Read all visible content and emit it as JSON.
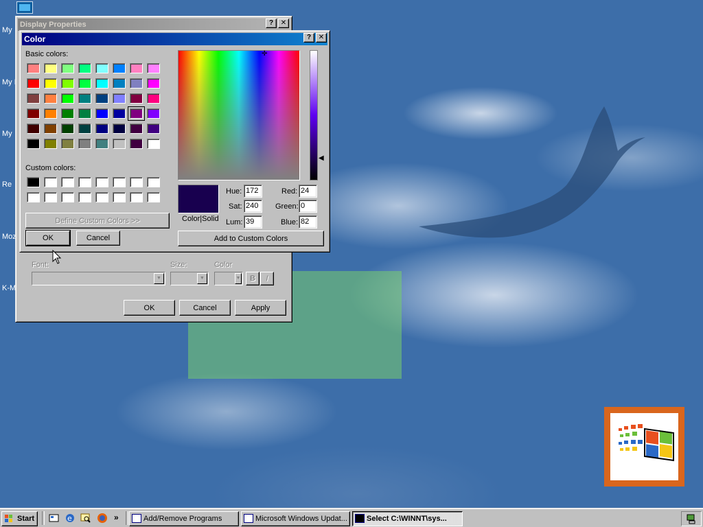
{
  "desktop": {
    "icon_labels": [
      "My",
      "My D",
      "My",
      "Re",
      "Moz",
      "K-M"
    ]
  },
  "display_properties": {
    "title": "Display Properties",
    "font_label": "Font:",
    "size_label": "Size:",
    "color_label": "Color",
    "bold_label": "B",
    "italic_label": "I",
    "ok": "OK",
    "cancel": "Cancel",
    "apply": "Apply"
  },
  "color_dialog": {
    "title": "Color",
    "help": "?",
    "close": "✕",
    "basic_colors_label": "Basic colors:",
    "custom_colors_label": "Custom colors:",
    "define_custom": "Define Custom Colors >>",
    "ok": "OK",
    "cancel": "Cancel",
    "add_custom": "Add to Custom Colors",
    "color_solid_label": "Color|Solid",
    "preview_color": "#18004f",
    "hue_label": "Hue:",
    "hue": "172",
    "sat_label": "Sat:",
    "sat": "240",
    "lum_label": "Lum:",
    "lum": "39",
    "red_label": "Red:",
    "red": "24",
    "green_label": "Green:",
    "green": "0",
    "blue_label": "Blue:",
    "blue": "82",
    "basic_colors": [
      [
        "#ff8080",
        "#ffff80",
        "#80ff80",
        "#00ff80",
        "#80ffff",
        "#0080ff",
        "#ff80c0",
        "#ff80ff"
      ],
      [
        "#ff0000",
        "#ffff00",
        "#80ff00",
        "#00ff40",
        "#00ffff",
        "#0080c0",
        "#8080c0",
        "#ff00ff"
      ],
      [
        "#804040",
        "#ff8040",
        "#00ff00",
        "#008080",
        "#004080",
        "#8080ff",
        "#800040",
        "#ff0080"
      ],
      [
        "#800000",
        "#ff8000",
        "#008000",
        "#008040",
        "#0000ff",
        "#0000a0",
        "#800080",
        "#8000ff"
      ],
      [
        "#400000",
        "#804000",
        "#004000",
        "#004040",
        "#000080",
        "#000040",
        "#400040",
        "#400080"
      ],
      [
        "#000000",
        "#808000",
        "#808040",
        "#808080",
        "#408080",
        "#c0c0c0",
        "#400040",
        "#ffffff"
      ]
    ],
    "selected_basic": [
      3,
      6
    ],
    "custom_colors": [
      [
        "#000000",
        "#ffffff",
        "#ffffff",
        "#ffffff",
        "#ffffff",
        "#ffffff",
        "#ffffff",
        "#ffffff"
      ],
      [
        "#ffffff",
        "#ffffff",
        "#ffffff",
        "#ffffff",
        "#ffffff",
        "#ffffff",
        "#ffffff",
        "#ffffff"
      ]
    ]
  },
  "taskbar": {
    "start": "Start",
    "chevron": "»",
    "tasks": [
      {
        "label": "Add/Remove Programs",
        "active": false
      },
      {
        "label": "Microsoft Windows Updat...",
        "active": false
      },
      {
        "label": "Select C:\\WINNT\\sys...",
        "active": true
      }
    ]
  },
  "colors": {
    "desktop": "#3d6ea9",
    "active_title": "#000080",
    "inactive_title": "#808080",
    "face": "#c0c0c0"
  }
}
